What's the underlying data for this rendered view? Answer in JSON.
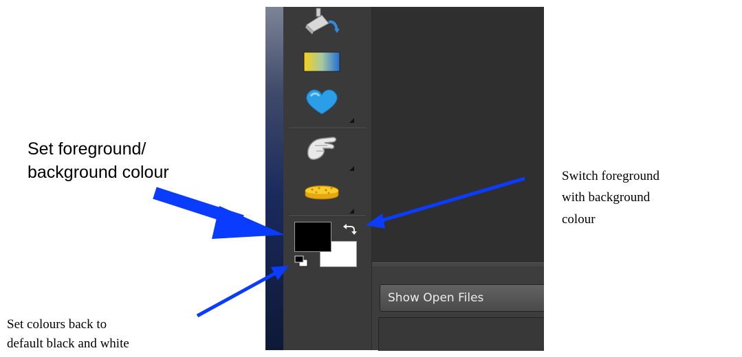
{
  "toolbar": {
    "tools": [
      {
        "name": "paint-bucket-icon"
      },
      {
        "name": "gradient-icon"
      },
      {
        "name": "custom-shape-icon"
      },
      {
        "name": "smudge-icon"
      },
      {
        "name": "sponge-icon"
      }
    ]
  },
  "color_swatches": {
    "foreground_color": "#000000",
    "background_color": "#ffffff",
    "swap_icon": "swap-arrows-icon",
    "default_icon": "default-colors-icon"
  },
  "photo_bin": {
    "show_open_files_label": "Show Open Files"
  },
  "annotations": {
    "set_fg_bg_line1": "Set foreground/",
    "set_fg_bg_line2": "background colour",
    "switch_line1": "Switch foreground",
    "switch_line2": "with background",
    "switch_line3": "colour",
    "default_line1": "Set colours back to",
    "default_line2": "default black and white"
  },
  "colors": {
    "arrow": "#0a3cff",
    "panel": "#3a3a3a"
  }
}
